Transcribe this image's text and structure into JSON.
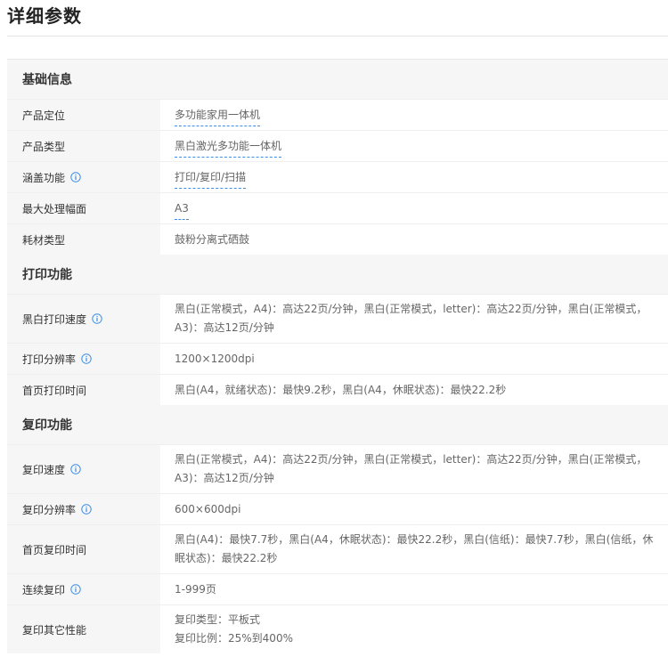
{
  "page_title": "详细参数",
  "sections": [
    {
      "title": "基础信息",
      "rows": [
        {
          "key": "产品定位",
          "value": "多功能家用一体机",
          "link": true
        },
        {
          "key": "产品类型",
          "value": "黑白激光多功能一体机",
          "link": true
        },
        {
          "key": "涵盖功能",
          "value": "打印/复印/扫描",
          "link": true,
          "info": true
        },
        {
          "key": "最大处理幅面",
          "value": "A3",
          "link": true
        },
        {
          "key": "耗材类型",
          "value": "鼓粉分离式硒鼓"
        }
      ]
    },
    {
      "title": "打印功能",
      "rows": [
        {
          "key": "黑白打印速度",
          "value": "黑白(正常模式，A4)：高达22页/分钟，黑白(正常模式，letter)：高达22页/分钟，黑白(正常模式，A3)：高达12页/分钟",
          "info": true
        },
        {
          "key": "打印分辨率",
          "value": "1200×1200dpi",
          "info": true
        },
        {
          "key": "首页打印时间",
          "value": "黑白(A4，就绪状态)：最快9.2秒，黑白(A4，休眠状态)：最快22.2秒"
        }
      ]
    },
    {
      "title": "复印功能",
      "rows": [
        {
          "key": "复印速度",
          "value": "黑白(正常模式，A4)：高达22页/分钟，黑白(正常模式，letter)：高达22页/分钟，黑白(正常模式，A3)：高达12页/分钟",
          "info": true
        },
        {
          "key": "复印分辨率",
          "value": "600×600dpi",
          "info": true
        },
        {
          "key": "首页复印时间",
          "value": "黑白(A4)：最快7.7秒，黑白(A4，休眠状态)：最快22.2秒，黑白(信纸)：最快7.7秒，黑白(信纸，休眠状态)：最快22.2秒"
        },
        {
          "key": "连续复印",
          "value": "1-999页",
          "info": true
        },
        {
          "key": "复印其它性能",
          "value_lines": [
            "复印类型：平板式",
            "复印比例：25%到400%"
          ]
        }
      ]
    }
  ],
  "icons": {
    "info": "info-circle-icon"
  },
  "colors": {
    "link": "#3a8ee6",
    "info_icon": "#3a8ee6",
    "section_bg": "#f6f6f6"
  }
}
